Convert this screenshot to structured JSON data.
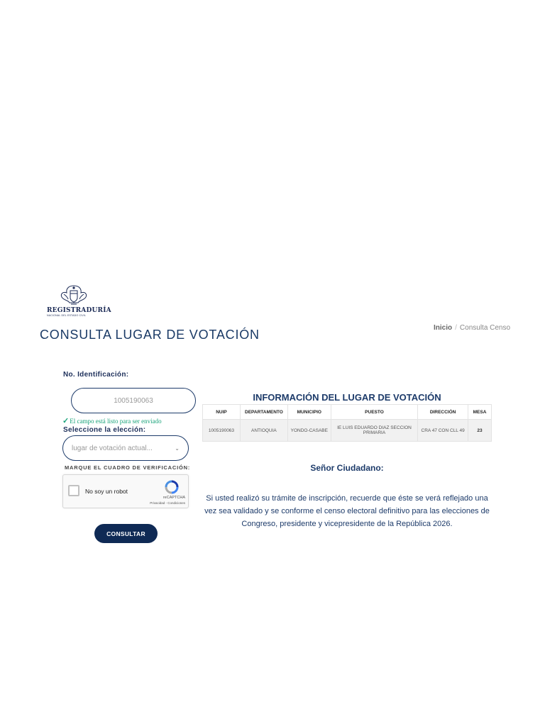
{
  "header": {
    "logo": {
      "line1": "REGISTRADURÍA",
      "line2": "NACIONAL DEL ESTADO CIVIL",
      "icon": "coat-of-arms-icon"
    },
    "page_title": "CONSULTA LUGAR DE VOTACIÓN",
    "breadcrumb": {
      "home": "Inicio",
      "separator": "/",
      "current": "Consulta Censo"
    }
  },
  "form": {
    "id_label": "No. Identificación:",
    "id_value": "1005190063",
    "validation_check": "✓",
    "validation_msg": "El campo está listo para ser enviado",
    "election_label": "Seleccione la elección:",
    "election_selected": "lugar de votación actual...",
    "verify_label": "MARQUE EL CUADRO DE VERIFICACIÓN:",
    "captcha": {
      "text": "No soy un robot",
      "brand": "reCAPTCHA",
      "links": "Privacidad - Condiciones"
    },
    "submit_label": "CONSULTAR"
  },
  "results": {
    "title": "INFORMACIÓN DEL LUGAR DE VOTACIÓN",
    "columns": [
      "NUIP",
      "DEPARTAMENTO",
      "MUNICIPIO",
      "PUESTO",
      "DIRECCIÓN",
      "MESA"
    ],
    "row": [
      "1005190063",
      "ANTIOQUIA",
      "YONDO-CASABE",
      "IE LUIS EDUARDO DIAZ SECCION PRIMARIA",
      "CRA 47 CON CLL 49",
      "23"
    ]
  },
  "notice": {
    "greeting": "Señor Ciudadano:",
    "text": "Si usted realizó su trámite de inscripción, recuerde que éste se verá reflejado una vez sea validado y se conforme el censo electoral definitivo para las elecciones de Congreso, presidente y vicepresidente de la República 2026."
  },
  "colors": {
    "primary": "#0f2a55",
    "title": "#1a3a66",
    "success": "#1aa37a",
    "table_row_bg": "#f1f1f1"
  }
}
